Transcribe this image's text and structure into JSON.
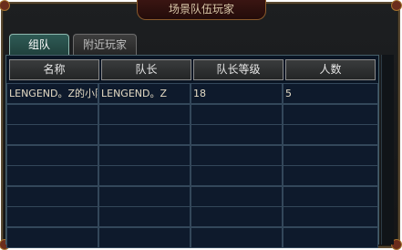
{
  "window": {
    "title": "场景队伍玩家"
  },
  "tabs": [
    {
      "label": "组队",
      "active": true
    },
    {
      "label": "附近玩家",
      "active": false
    }
  ],
  "table": {
    "columns": [
      "名称",
      "队长",
      "队长等级",
      "人数"
    ],
    "rows": [
      [
        "LENGEND。Z的小队",
        "LENGEND。Z",
        "18",
        "5"
      ],
      [
        "",
        "",
        "",
        ""
      ],
      [
        "",
        "",
        "",
        ""
      ],
      [
        "",
        "",
        "",
        ""
      ],
      [
        "",
        "",
        "",
        ""
      ],
      [
        "",
        "",
        "",
        ""
      ],
      [
        "",
        "",
        "",
        ""
      ],
      [
        "",
        "",
        "",
        ""
      ]
    ]
  },
  "colors": {
    "accent": "#2f5b55",
    "frame": "#5a4a32",
    "text": "#e2d9c3"
  }
}
